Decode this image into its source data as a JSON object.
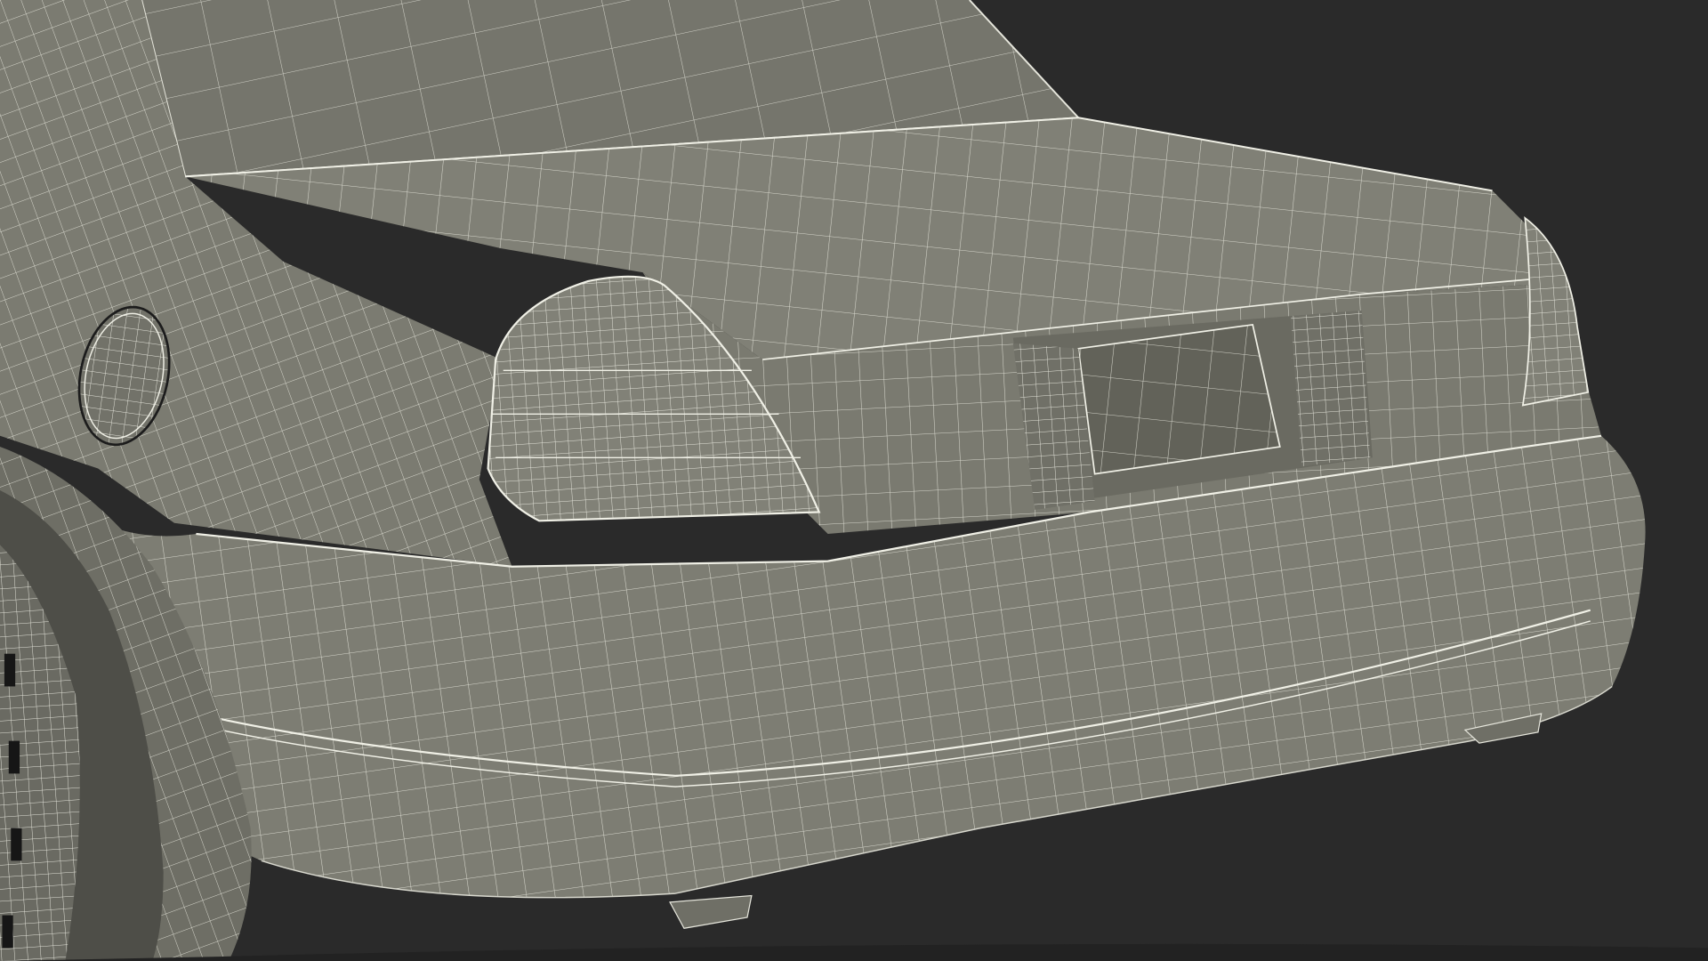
{
  "scene": {
    "subject": "wireframe-sedan-rear",
    "colors": {
      "background": "#2a2a2a",
      "body": "#7b7b71",
      "body_dark": "#6a6a61",
      "body_shadow": "#5c5c55",
      "body_light": "#86867c",
      "wire": "#e6e6dc",
      "tire": "#1e1e1e",
      "slot": "#161616"
    }
  }
}
